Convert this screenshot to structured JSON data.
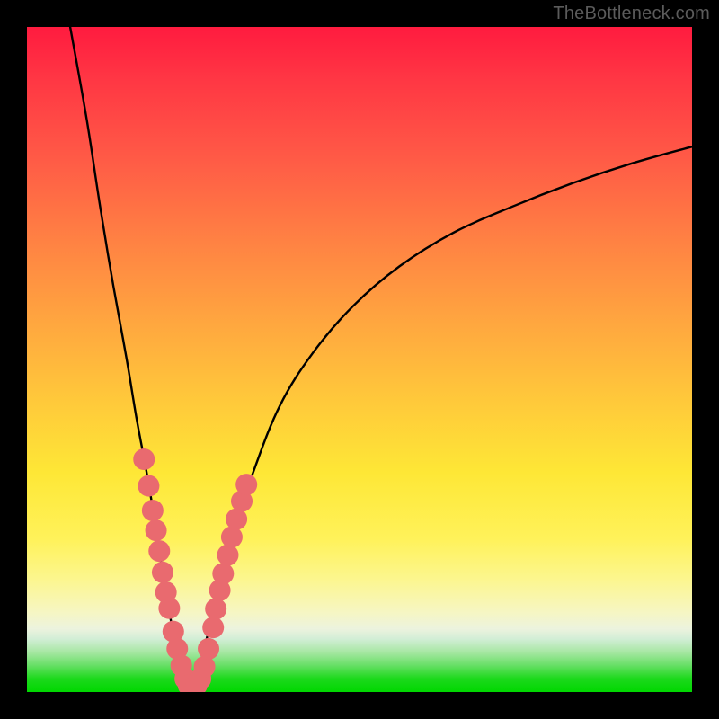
{
  "watermark": {
    "text": "TheBottleneck.com"
  },
  "colors": {
    "frame": "#000000",
    "curve": "#000000",
    "marker_fill": "#e96a6f",
    "marker_stroke": "#d45a60",
    "gradient_stops": [
      "#ff1b3f",
      "#ff3744",
      "#ff5b46",
      "#ff8443",
      "#ffa83f",
      "#ffcb3a",
      "#fee736",
      "#fff25a",
      "#fcf68e",
      "#f6f6c3",
      "#ecf3de",
      "#d2eed6",
      "#a7e7a3",
      "#67df66",
      "#1cd91c",
      "#00d700"
    ]
  },
  "chart_data": {
    "type": "line",
    "title": "",
    "xlabel": "",
    "ylabel": "",
    "x_range": [
      0,
      100
    ],
    "y_range": [
      0,
      100
    ],
    "description": "V-shaped bottleneck curve. y≈0 at the trough (~x=24), rising steeply on both sides; left branch reaches y≈100 near x=6, right branch rises with diminishing slope toward y≈82 at x=100.",
    "series": [
      {
        "name": "left-branch",
        "x": [
          6.5,
          9,
          11,
          13,
          15,
          16.5,
          18,
          19.5,
          20.7,
          22,
          23.5,
          24.5
        ],
        "y": [
          100,
          86,
          73,
          61,
          50,
          41,
          33,
          24,
          16,
          9,
          3,
          0
        ]
      },
      {
        "name": "right-branch",
        "x": [
          24.5,
          26,
          27.5,
          29,
          31,
          34,
          38,
          43,
          49,
          56,
          64,
          73,
          82,
          91,
          100
        ],
        "y": [
          0,
          4,
          10,
          16,
          24,
          33,
          43,
          51,
          58,
          64,
          69,
          73,
          76.5,
          79.5,
          82
        ]
      }
    ],
    "markers": {
      "name": "highlighted-points",
      "note": "Salmon bead-like markers clustered along the lower V, forming two short runs on the left arm (~y 12–34) and right arm (~y 6–30) plus the floor.",
      "points": [
        {
          "x": 17.6,
          "y": 35.0,
          "r": 1.0
        },
        {
          "x": 18.3,
          "y": 31.0,
          "r": 1.2
        },
        {
          "x": 18.9,
          "y": 27.3,
          "r": 1.2
        },
        {
          "x": 19.4,
          "y": 24.3,
          "r": 1.2
        },
        {
          "x": 19.9,
          "y": 21.2,
          "r": 1.2
        },
        {
          "x": 20.4,
          "y": 18.0,
          "r": 1.2
        },
        {
          "x": 20.9,
          "y": 15.0,
          "r": 1.0
        },
        {
          "x": 21.4,
          "y": 12.6,
          "r": 1.0
        },
        {
          "x": 22.0,
          "y": 9.1,
          "r": 1.2
        },
        {
          "x": 22.6,
          "y": 6.5,
          "r": 1.2
        },
        {
          "x": 23.2,
          "y": 4.0,
          "r": 1.2
        },
        {
          "x": 23.8,
          "y": 2.0,
          "r": 1.0
        },
        {
          "x": 24.3,
          "y": 1.0,
          "r": 1.0
        },
        {
          "x": 24.9,
          "y": 0.6,
          "r": 1.2
        },
        {
          "x": 25.5,
          "y": 1.0,
          "r": 1.2
        },
        {
          "x": 26.1,
          "y": 2.0,
          "r": 1.2
        },
        {
          "x": 26.7,
          "y": 3.8,
          "r": 1.0
        },
        {
          "x": 27.3,
          "y": 6.5,
          "r": 1.0
        },
        {
          "x": 28.0,
          "y": 9.7,
          "r": 1.2
        },
        {
          "x": 28.4,
          "y": 12.5,
          "r": 1.2
        },
        {
          "x": 29.0,
          "y": 15.3,
          "r": 1.2
        },
        {
          "x": 29.5,
          "y": 17.8,
          "r": 1.0
        },
        {
          "x": 30.2,
          "y": 20.6,
          "r": 1.2
        },
        {
          "x": 30.8,
          "y": 23.3,
          "r": 1.2
        },
        {
          "x": 31.5,
          "y": 26.0,
          "r": 1.2
        },
        {
          "x": 32.3,
          "y": 28.7,
          "r": 1.0
        },
        {
          "x": 33.0,
          "y": 31.2,
          "r": 1.0
        }
      ]
    }
  }
}
